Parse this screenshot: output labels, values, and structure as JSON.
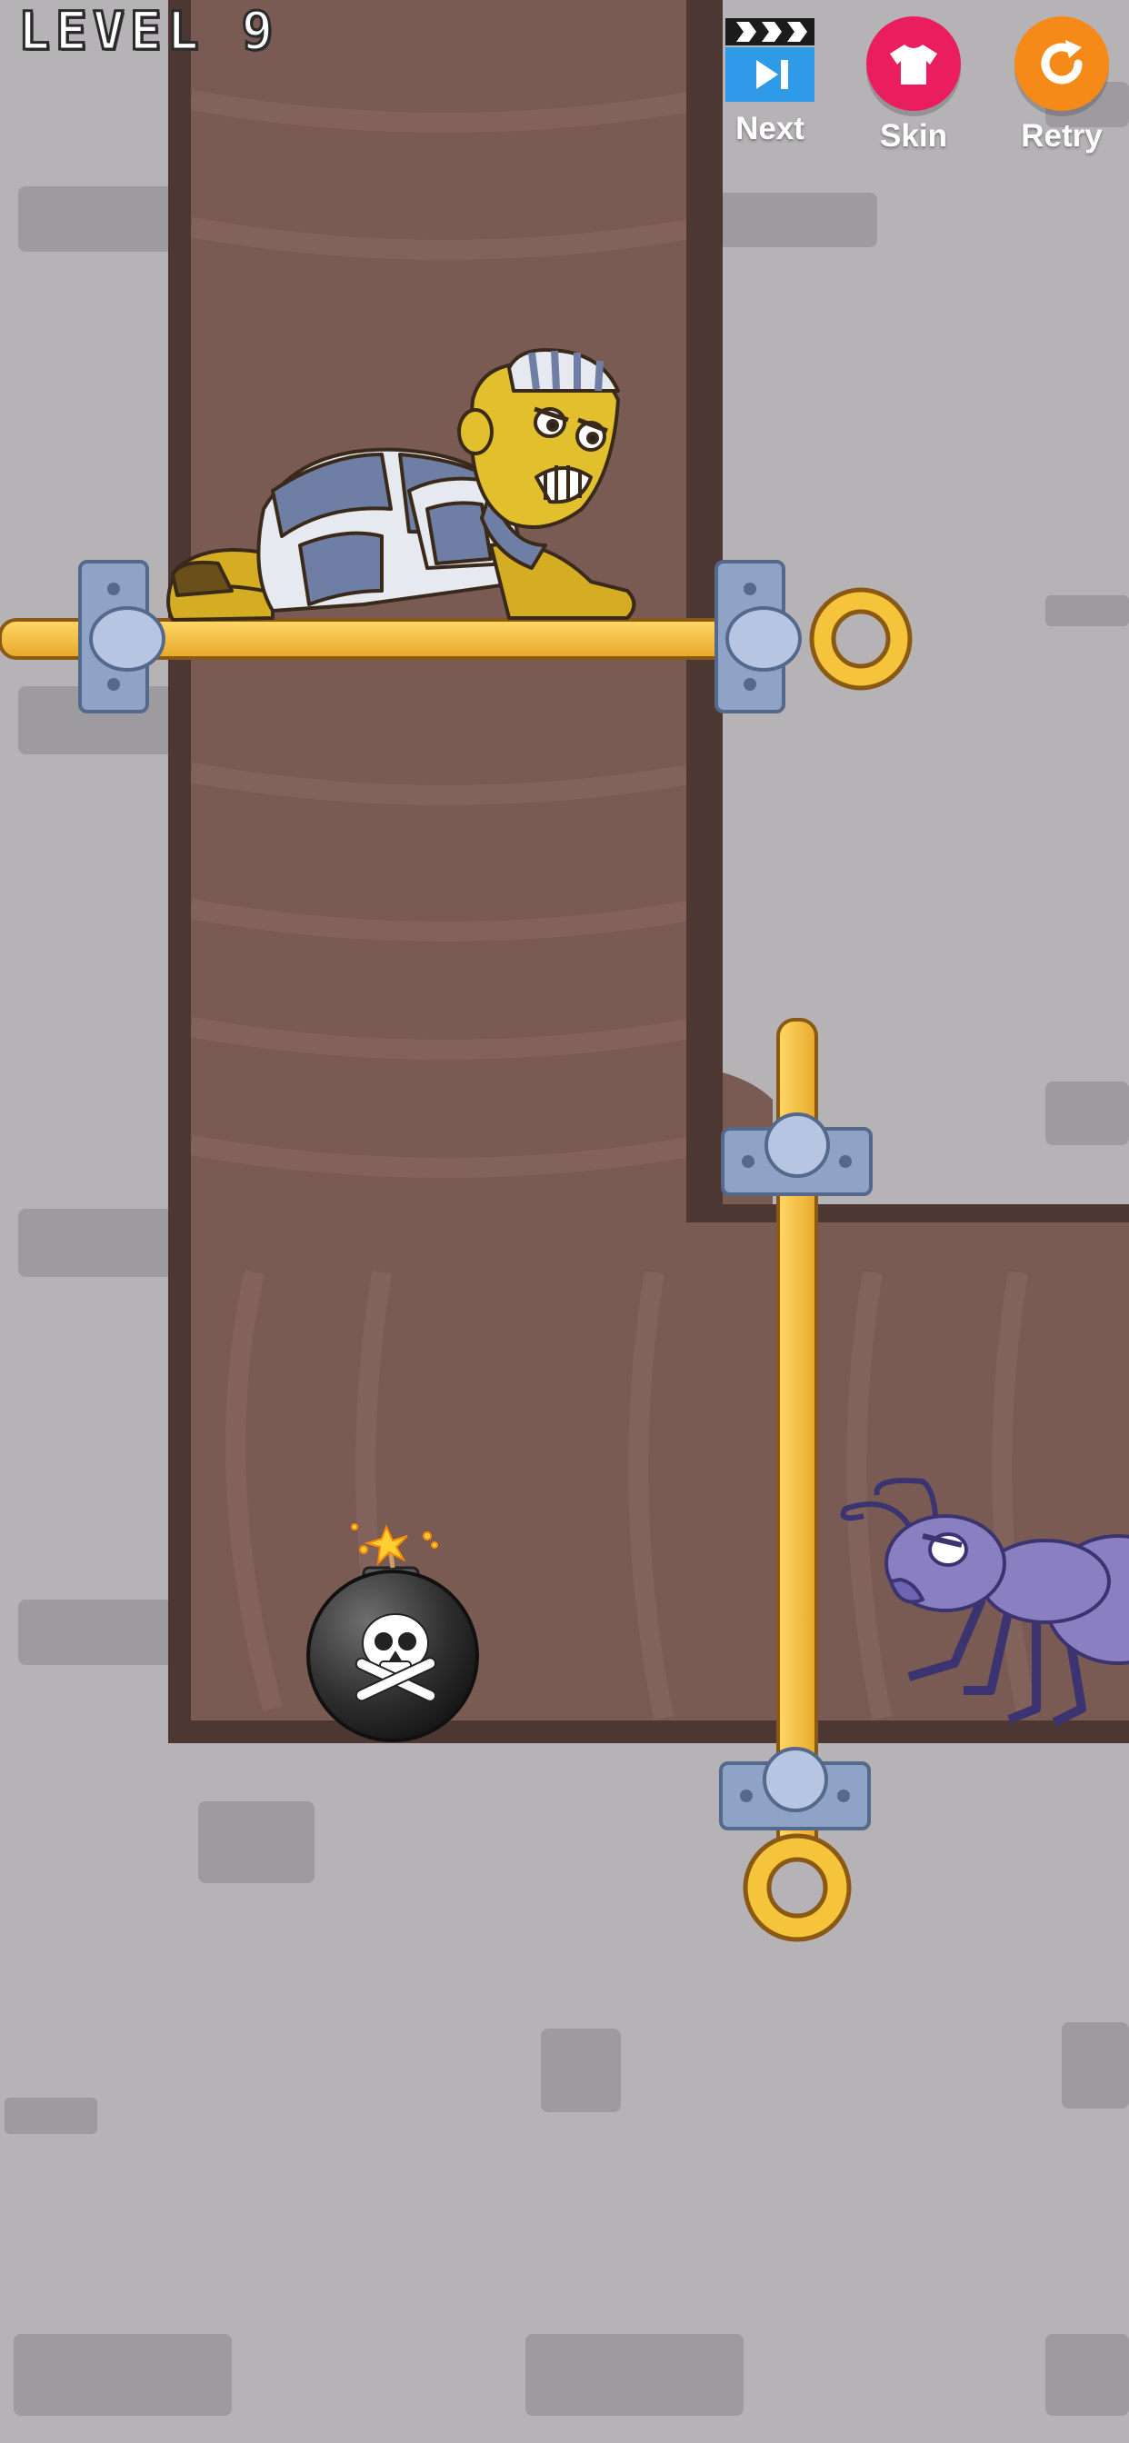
{
  "hud": {
    "level_label": "LEVEL 9",
    "next_label": "Next",
    "skin_label": "Skin",
    "retry_label": "Retry",
    "next_icon": "skip-forward-clapperboard-icon",
    "skin_icon": "tshirt-icon",
    "retry_icon": "retry-arrow-icon"
  },
  "colors": {
    "wall": "#b6b3b7",
    "brick": "#9e9ba0",
    "shaft": "#7a5b54",
    "shaft_edge": "#4a3631",
    "pin_gold": "#f2be3f",
    "pin_outline": "#8a5a14",
    "clamp": "#8fa3c6",
    "next_button": "#2f9ae8",
    "skin_button": "#ea1e5e",
    "retry_button": "#f58a18"
  },
  "scene": {
    "prisoner": "prisoner character",
    "bomb": "skull bomb",
    "enemy": "purple ant",
    "pins": [
      "horizontal pin",
      "vertical pin"
    ]
  }
}
